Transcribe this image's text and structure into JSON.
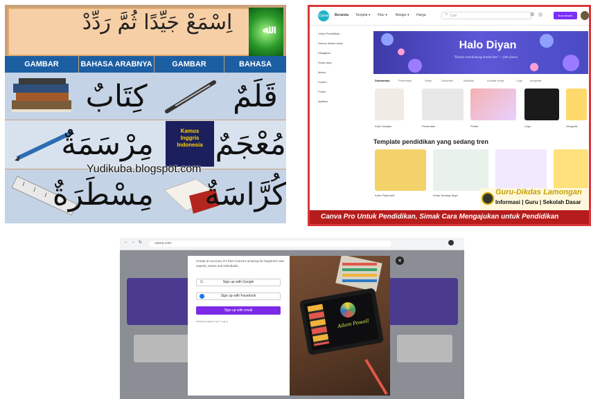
{
  "panel1": {
    "phrase": "اِسْمَعْ جَيِّدًا ثُمَّ رَدِّدْ",
    "logo_text": "ﷲ",
    "column_headers": [
      "GAMBAR",
      "BAHASA ARABNYA",
      "GAMBAR",
      "BAHASA ARABNY"
    ],
    "words": [
      "كِتَابٌ",
      "قَلَمٌ",
      "مِرْسَمَةٌ",
      "مُعْجَمٌ",
      "مِسْطَرَةٌ",
      "كُرَّاسَةٌ"
    ],
    "dictionary_cover": "Kamus Inggris Indonesia",
    "watermark": "Yudikuba.blogspot.com",
    "colors": {
      "header_blue": "#1c5ea2",
      "banner": "#f6cfa6",
      "frame": "#c7a079"
    }
  },
  "panel2": {
    "app": "Canva",
    "nav": [
      "Beranda",
      "Templat ▾",
      "Fitur ▾",
      "Belajar ▾",
      "Harga"
    ],
    "search_placeholder": "Cari",
    "create_button": "Buat desain",
    "sidebar": [
      "Untuk Pendidikan",
      "Semua desain anda",
      "Dibagikan",
      "Kelas saya",
      "Merek",
      "Konten",
      "Folder",
      "Aplikasi"
    ],
    "banner_title": "Halo Diyan",
    "banner_subtitle": "\"Desain mendukung kreativitas\" — John Janus",
    "tabs": [
      "Disarankan",
      "Presentasi",
      "Video",
      "Dokumen",
      "Aktivitas",
      "Lembar Kerja",
      "Logo",
      "Infografis"
    ],
    "template_labels": [
      "Kartu Ucapan",
      "Presentasi",
      "Poster",
      "Logo",
      "Infografis"
    ],
    "trend_heading": "Template pendidikan yang sedang tren",
    "trend_labels": [
      "Kartu Flashcard",
      "Kelas Tentang Saya"
    ],
    "brand_name": "Guru-Dikdas Lamongan",
    "brand_tagline": "Informasi | Guru | Sekolah Dasar",
    "footer": "Canva Pro Untuk Pendidikan, Simak Cara Mengajukan untuk Pendidikan",
    "colors": {
      "accent": "#7b2ff7",
      "footer": "#b71c1c",
      "banner": "#4a4ac4"
    }
  },
  "panel3": {
    "url": "canva.com",
    "modal_text": "Create an account, it's free! Canva's amazing for beginners and experts, teams and individuals.",
    "btn_google": "Sign up with Google",
    "btn_facebook": "Sign up with Facebook",
    "btn_email": "Sign up with email",
    "login_link": "Already signed up? Log in",
    "tablet_sign": "Adam Powell",
    "close": "×",
    "colors": {
      "accent": "#7d2ae8"
    }
  }
}
